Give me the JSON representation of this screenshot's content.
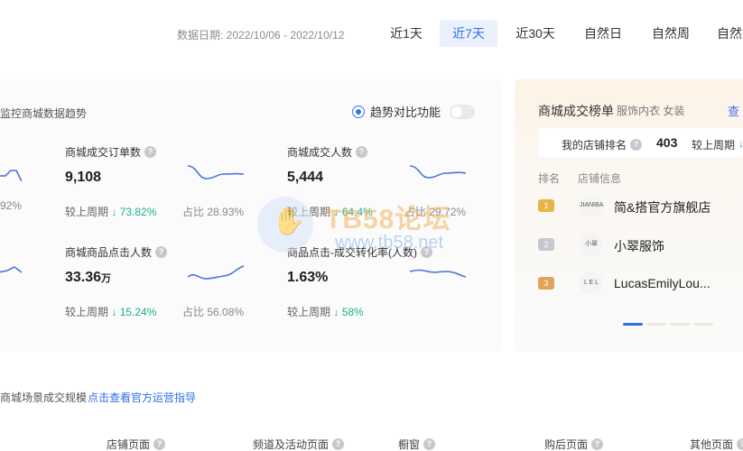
{
  "date_bar": {
    "label": "数据日期:  2022/10/06 - 2022/10/12",
    "ranges": [
      "近1天",
      "近7天",
      "近30天",
      "自然日",
      "自然周",
      "自然"
    ],
    "active_index": 1
  },
  "panel": {
    "title": "监控商城数据趋势",
    "compare_label": "趋势对比功能",
    "compare_toggle_on": false,
    "left_edge": {
      "top_share": "92%"
    },
    "metrics": [
      {
        "label": "商城成交订单数",
        "value": "9,108",
        "unit": "",
        "trend_label": "较上周期",
        "trend_value": "73.82%",
        "trend_arrow": "↓",
        "share": "占比 28.93%"
      },
      {
        "label": "商城成交人数",
        "value": "5,444",
        "unit": "",
        "trend_label": "较上周期",
        "trend_value": "64.4%",
        "trend_arrow": "↓",
        "share": "占比 29.72%"
      },
      {
        "label": "商城商品点击人数",
        "value": "33.36",
        "unit": "万",
        "trend_label": "较上周期",
        "trend_value": "15.24%",
        "trend_arrow": "↓",
        "share": "占比 56.08%"
      },
      {
        "label": "商品点击-成交转化率(人数)",
        "value": "1.63%",
        "unit": "",
        "trend_label": "较上周期",
        "trend_value": "58%",
        "trend_arrow": "↓",
        "share": ""
      }
    ]
  },
  "ranking": {
    "title": "商城成交榜单",
    "subtitle": "服饰内衣 女装",
    "link": "查",
    "my_rank_label": "我的店铺排名",
    "my_rank_value": "403",
    "my_rank_prev": "较上周期",
    "my_rank_arrow": "↓",
    "col_rank": "排名",
    "col_shop": "店铺信息",
    "shops": [
      {
        "rank": "1",
        "logo": "JIANIBA",
        "name": "简&搭官方旗舰店"
      },
      {
        "rank": "2",
        "logo": "小翠",
        "name": "小翠服饰"
      },
      {
        "rank": "3",
        "logo": "L E L",
        "name": "LucasEmilyLou..."
      }
    ]
  },
  "watermark": {
    "brand": "TB58论坛",
    "url": "www.tb58.net"
  },
  "bottom": {
    "label": "商城场景成交规模",
    "link": "点击查看官方运营指导",
    "columns": [
      "店铺页面",
      "频道及活动页面",
      "橱窗",
      "购后页面",
      "其他页面"
    ]
  },
  "colors": {
    "accent": "#2f6fe4",
    "down": "#1eae8c"
  }
}
